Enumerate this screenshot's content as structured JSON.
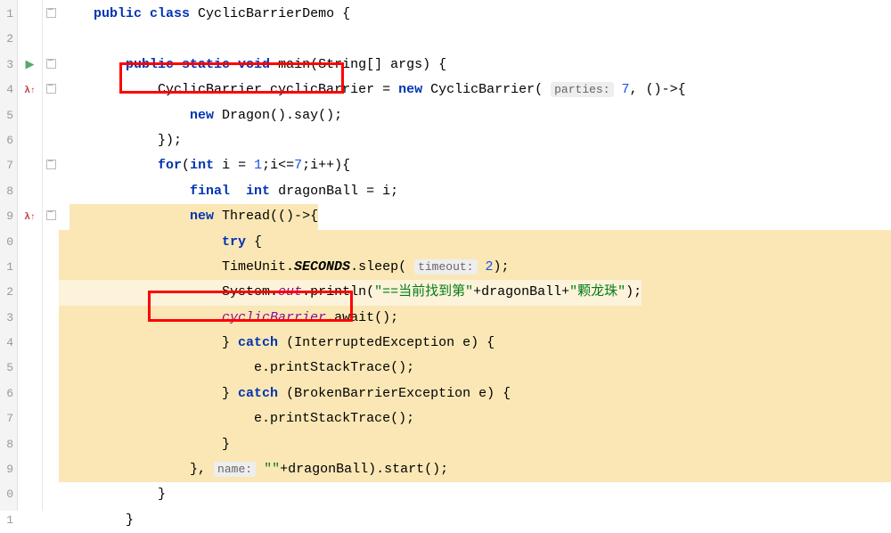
{
  "gutter": {
    "start": 1,
    "lines": [
      "1",
      "2",
      "3",
      "4",
      "5",
      "6",
      "7",
      "8",
      "9",
      "0",
      "1",
      "2",
      "3",
      "4",
      "5",
      "6",
      "7",
      "8",
      "9",
      "0",
      "1"
    ]
  },
  "code": {
    "l1_1": "public",
    "l1_2": " class",
    "l1_3": " CyclicBarrierDemo {",
    "l3_1": "public",
    "l3_2": " static",
    "l3_3": " void",
    "l3_4": " main",
    "l3_5": "(String[] args) {",
    "l4_1": "CyclicBarrier cyclicBarrier = ",
    "l4_2": "new",
    "l4_3": " CyclicBarrier( ",
    "l4_param": "parties:",
    "l4_4": " 7",
    "l4_5": ", ()->{",
    "l5_1": "new",
    "l5_2": " Dragon().say();",
    "l6_1": "});",
    "l7_1": "for",
    "l7_2": "(",
    "l7_3": "int",
    "l7_4": " i = ",
    "l7_5": "1",
    "l7_6": ";i<=",
    "l7_7": "7",
    "l7_8": ";i++){",
    "l8_1": "final",
    "l8_2": "  int",
    "l8_3": " dragonBall = i;",
    "l9_1": "new",
    "l9_2": " Thread(()->{",
    "l10_1": "try",
    "l10_2": " {",
    "l11_1": "TimeUnit.",
    "l11_2": "SECONDS",
    "l11_3": ".sleep( ",
    "l11_param": "timeout:",
    "l11_4": " 2",
    "l11_5": ");",
    "l12_1": "System.",
    "l12_2": "out",
    "l12_3": ".println(",
    "l12_4": "\"==当前找到第\"",
    "l12_5": "+dragonBall+",
    "l12_6": "\"颗龙珠\"",
    "l12_7": ");",
    "l13_1": "cyclicBarrier",
    "l13_2": ".await();",
    "l14_1": "} ",
    "l14_2": "catch",
    "l14_3": " (InterruptedException e) {",
    "l15_1": "e.printStackTrace();",
    "l16_1": "} ",
    "l16_2": "catch",
    "l16_3": " (BrokenBarrierException e) {",
    "l17_1": "e.printStackTrace();",
    "l18_1": "}",
    "l19_1": "}, ",
    "l19_param": "name:",
    "l19_2": " \"\"",
    "l19_3": "+dragonBall).start();",
    "l20_1": "}",
    "l21_1": "}"
  },
  "chart_data": null
}
